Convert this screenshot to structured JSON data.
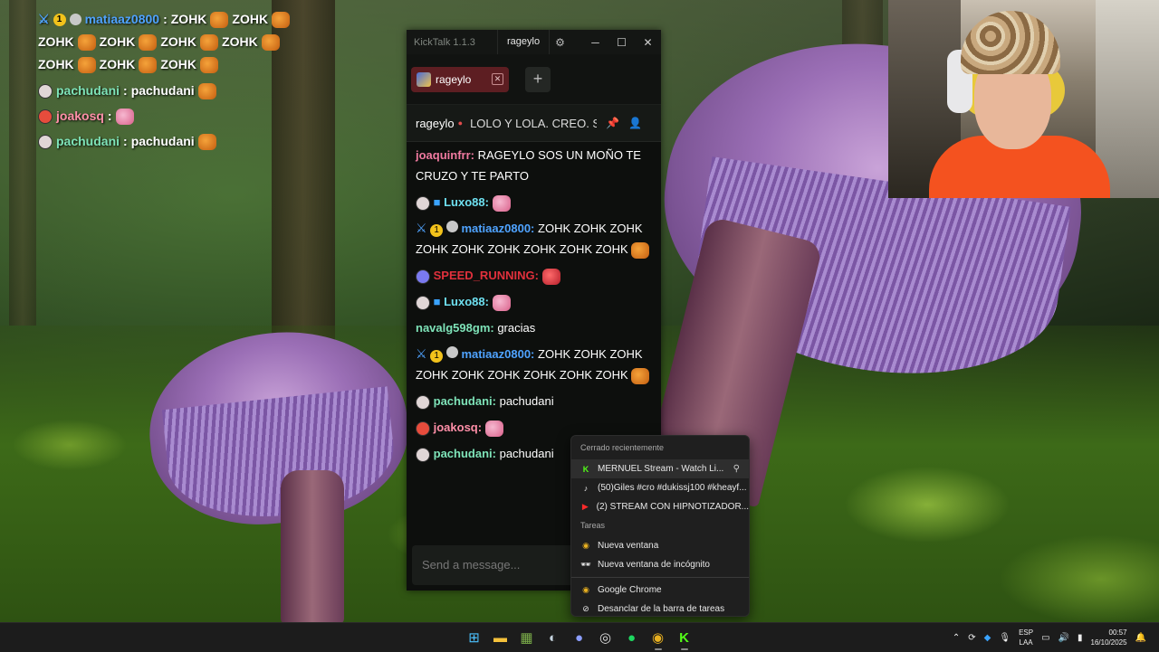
{
  "overlay_chat": [
    {
      "badges": [
        "sword",
        "sub",
        "gray"
      ],
      "user": "matiaaz0800",
      "user_color": "#4fa3ff",
      "text": "ZOHK",
      "after": "ZOHK"
    },
    {
      "text_row": [
        "ZOHK",
        "ZOHK",
        "ZOHK",
        "ZOHK"
      ]
    },
    {
      "text_row": [
        "ZOHK",
        "ZOHK",
        "ZOHK"
      ]
    },
    {
      "user": "pachudani",
      "user_color": "#7ee3b8",
      "text": "pachudani"
    },
    {
      "user": "joakosq",
      "user_color": "#ff8fa8",
      "text": ""
    },
    {
      "user": "pachudani",
      "user_color": "#7ee3b8",
      "text": "pachudani"
    }
  ],
  "kicktalk": {
    "app_title": "KickTalk 1.1.3",
    "title_tab": "rageylo",
    "tab_label": "rageylo",
    "add_label": "+",
    "channel_name": "rageylo",
    "stream_title": "LOLO Y LOLA. CREO. S...",
    "input_placeholder": "Send a message...",
    "messages": [
      {
        "user": "joaquinfrr:",
        "color": "#f07aa0",
        "text": "RAGEYLO SOS UN MOÑO TE CRUZO Y TE PARTO"
      },
      {
        "user": "Luxo88:",
        "color": "#6ee0f0",
        "text": ""
      },
      {
        "user": "matiaaz0800:",
        "color": "#4fa3ff",
        "text": "ZOHK  ZOHK  ZOHK  ZOHK  ZOHK  ZOHK  ZOHK  ZOHK  ZOHK"
      },
      {
        "user": "SPEED_RUNNING:",
        "color": "#e0303c",
        "text": ""
      },
      {
        "user": "Luxo88:",
        "color": "#6ee0f0",
        "text": ""
      },
      {
        "user": "navalg598gm:",
        "color": "#7ee3b8",
        "text": "gracias"
      },
      {
        "user": "matiaaz0800:",
        "color": "#4fa3ff",
        "text": "ZOHK  ZOHK  ZOHK  ZOHK  ZOHK  ZOHK  ZOHK  ZOHK  ZOHK"
      },
      {
        "user": "pachudani:",
        "color": "#7ee3b8",
        "text": "pachudani"
      },
      {
        "user": "joakosq:",
        "color": "#ff8fa8",
        "text": ""
      },
      {
        "user": "pachudani:",
        "color": "#7ee3b8",
        "text": "pachudani"
      }
    ]
  },
  "jumplist": {
    "recent_header": "Cerrado recientemente",
    "recent": [
      {
        "label": "MERNUEL Stream - Watch Li...",
        "icon": "kick-icon"
      },
      {
        "label": "(50)Giles #cro #dukissj100 #kheayf...",
        "icon": "tiktok-icon"
      },
      {
        "label": "(2) STREAM CON HIPNOTIZADOR...",
        "icon": "youtube-icon"
      }
    ],
    "tasks_header": "Tareas",
    "tasks": [
      {
        "label": "Nueva ventana",
        "icon": "chrome-icon"
      },
      {
        "label": "Nueva ventana de incógnito",
        "icon": "incognito-icon"
      }
    ],
    "app_label": "Google Chrome",
    "unpin_label": "Desanclar de la barra de tareas"
  },
  "taskbar": {
    "lang_top": "ESP",
    "lang_bottom": "LAA",
    "time": "00:57",
    "date": "16/10/2025"
  }
}
